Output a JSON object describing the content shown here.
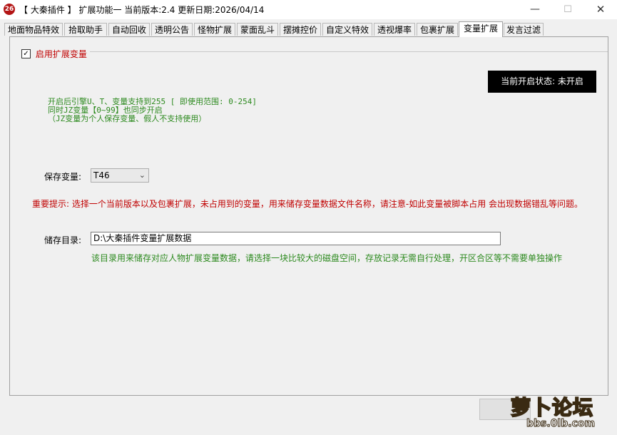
{
  "window": {
    "title": "【 大秦插件 】 扩展功能一 当前版本:2.4 更新日期:2026/04/14",
    "app_icon": "26",
    "controls": {
      "minimize": "—",
      "maximize": "☐",
      "close": "✕"
    }
  },
  "tabs": [
    {
      "label": "地面物品特效"
    },
    {
      "label": "拾取助手"
    },
    {
      "label": "自动回收"
    },
    {
      "label": "透明公告"
    },
    {
      "label": "怪物扩展"
    },
    {
      "label": "蒙面乱斗"
    },
    {
      "label": "摆摊控价"
    },
    {
      "label": "自定义特效"
    },
    {
      "label": "透视爆率"
    },
    {
      "label": "包裹扩展"
    },
    {
      "label": "变量扩展"
    },
    {
      "label": "发言过滤"
    }
  ],
  "active_tab": "变量扩展",
  "panel": {
    "enable_checkbox": {
      "checked": true,
      "mark": "✓",
      "label": "启用扩展变量"
    },
    "status": "当前开启状态: 未开启",
    "info_lines": [
      "开启后引擎U、T、变量支持到255 [ 即使用范围: 0-254]",
      "同时JZ变量【0~99】也同步开启",
      "（JZ变量为个人保存变量、假人不支持使用）"
    ],
    "save_var_label": "保存变量:",
    "save_var_value": "T46",
    "warning": "重要提示: 选择一个当前版本以及包裹扩展，未占用到的变量，用来储存变量数据文件名称，请注意-如此变量被脚本占用 会出现数据错乱等问题。",
    "dir_label": "储存目录:",
    "dir_value": "D:\\大秦插件变量扩展数据",
    "dir_note": "该目录用来储存对应人物扩展变量数据，请选择一块比较大的磁盘空间，存放记录无需自行处理，开区合区等不需要单独操作"
  },
  "watermark": {
    "title": "萝卜论坛",
    "url": "bbs.0lb.com"
  },
  "colors": {
    "accent_red": "#c00000",
    "accent_green": "#2d8a1f",
    "status_bg": "#000000"
  }
}
